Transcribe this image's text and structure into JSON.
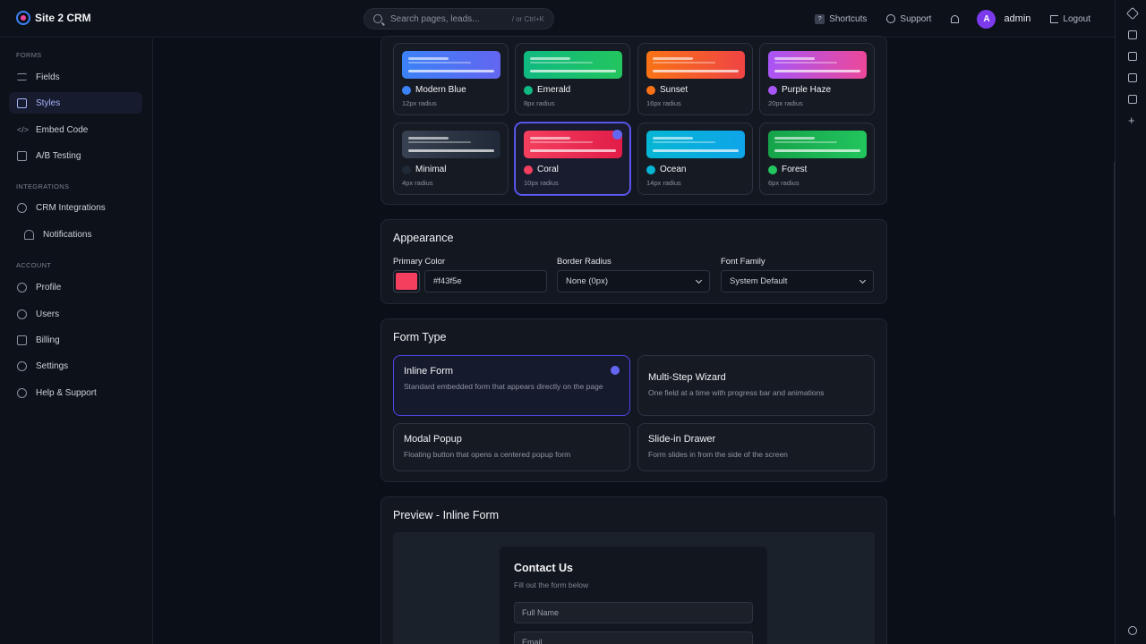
{
  "app": {
    "name": "Site 2 CRM"
  },
  "search": {
    "placeholder": "Search pages, leads...",
    "shortcut": "/ or Ctrl+K"
  },
  "topbar": {
    "shortcuts": "Shortcuts",
    "shortcuts_key": "?",
    "support": "Support",
    "avatar_initial": "A",
    "user": "admin",
    "logout": "Logout"
  },
  "sidebar": {
    "sections": [
      {
        "title": "FORMS",
        "items": [
          {
            "label": "Fields",
            "icon": "list-icon"
          },
          {
            "label": "Styles",
            "icon": "palette-icon",
            "active": true
          },
          {
            "label": "Embed Code",
            "icon": "code-icon"
          },
          {
            "label": "A/B Testing",
            "icon": "clipboard-icon"
          }
        ]
      },
      {
        "title": "INTEGRATIONS",
        "items": [
          {
            "label": "CRM Integrations",
            "icon": "link-icon"
          },
          {
            "label": "Notifications",
            "icon": "bell-icon"
          }
        ]
      },
      {
        "title": "ACCOUNT",
        "items": [
          {
            "label": "Profile",
            "icon": "user-icon"
          },
          {
            "label": "Users",
            "icon": "users-icon"
          },
          {
            "label": "Billing",
            "icon": "credit-card-icon"
          },
          {
            "label": "Settings",
            "icon": "gear-icon"
          },
          {
            "label": "Help & Support",
            "icon": "help-icon"
          }
        ]
      }
    ]
  },
  "themes": [
    {
      "name": "Modern Blue",
      "radius": "12px radius",
      "color": "#3b82f6",
      "gradient": [
        "#3b82f6",
        "#6366f1"
      ]
    },
    {
      "name": "Emerald",
      "radius": "8px radius",
      "color": "#10b981",
      "gradient": [
        "#10b981",
        "#22c55e"
      ]
    },
    {
      "name": "Sunset",
      "radius": "16px radius",
      "color": "#f97316",
      "gradient": [
        "#f97316",
        "#ef4444"
      ]
    },
    {
      "name": "Purple Haze",
      "radius": "20px radius",
      "color": "#a855f7",
      "gradient": [
        "#a855f7",
        "#ec4899"
      ]
    },
    {
      "name": "Minimal",
      "radius": "4px radius",
      "color": "#1f2937",
      "gradient": [
        "#374151",
        "#1f2937"
      ]
    },
    {
      "name": "Coral",
      "radius": "10px radius",
      "color": "#f43f5e",
      "gradient": [
        "#f43f5e",
        "#e11d48"
      ],
      "selected": true
    },
    {
      "name": "Ocean",
      "radius": "14px radius",
      "color": "#06b6d4",
      "gradient": [
        "#06b6d4",
        "#0ea5e9"
      ]
    },
    {
      "name": "Forest",
      "radius": "6px radius",
      "color": "#22c55e",
      "gradient": [
        "#16a34a",
        "#22c55e"
      ]
    }
  ],
  "appearance": {
    "title": "Appearance",
    "primary_color_label": "Primary Color",
    "primary_color": "#f43f5e",
    "primary_color_value": "#f43f5e",
    "border_radius_label": "Border Radius",
    "border_radius_value": "None (0px)",
    "font_family_label": "Font Family",
    "font_family_value": "System Default"
  },
  "form_type": {
    "title": "Form Type",
    "options": [
      {
        "title": "Inline Form",
        "desc": "Standard embedded form that appears directly on the page",
        "selected": true
      },
      {
        "title": "Multi-Step Wizard",
        "desc": "One field at a time with progress bar and animations"
      },
      {
        "title": "Modal Popup",
        "desc": "Floating button that opens a centered popup form"
      },
      {
        "title": "Slide-in Drawer",
        "desc": "Form slides in from the side of the screen"
      }
    ]
  },
  "preview": {
    "title": "Preview - Inline Form",
    "form_title": "Contact Us",
    "form_subtitle": "Fill out the form below",
    "fields": [
      "Full Name",
      "Email"
    ]
  }
}
